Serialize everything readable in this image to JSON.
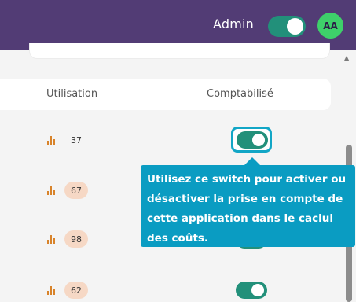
{
  "header": {
    "role_label": "Admin",
    "admin_toggle_on": true,
    "avatar_initials": "AA"
  },
  "table": {
    "columns": [
      "Utilisation",
      "Comptabilisé"
    ],
    "rows": [
      {
        "usage": "37",
        "counted": true
      },
      {
        "usage": "67",
        "counted": true
      },
      {
        "usage": "98",
        "counted": true
      },
      {
        "usage": "62",
        "counted": true
      }
    ]
  },
  "tooltip": {
    "text": "Utilisez ce switch pour activer ou désactiver la prise en compte de cette application dans le caclul des coûts."
  },
  "colors": {
    "header_bg": "#523c75",
    "toggle_on": "#22907a",
    "tooltip_bg": "#0a9cc2",
    "avatar_bg": "#3ed06a",
    "usage_icon": "#d8832a",
    "usage_pill": "#f6d8c5"
  },
  "icons": {
    "usage": "bar-chart-icon",
    "scroll_up": "triangle-up-icon"
  }
}
